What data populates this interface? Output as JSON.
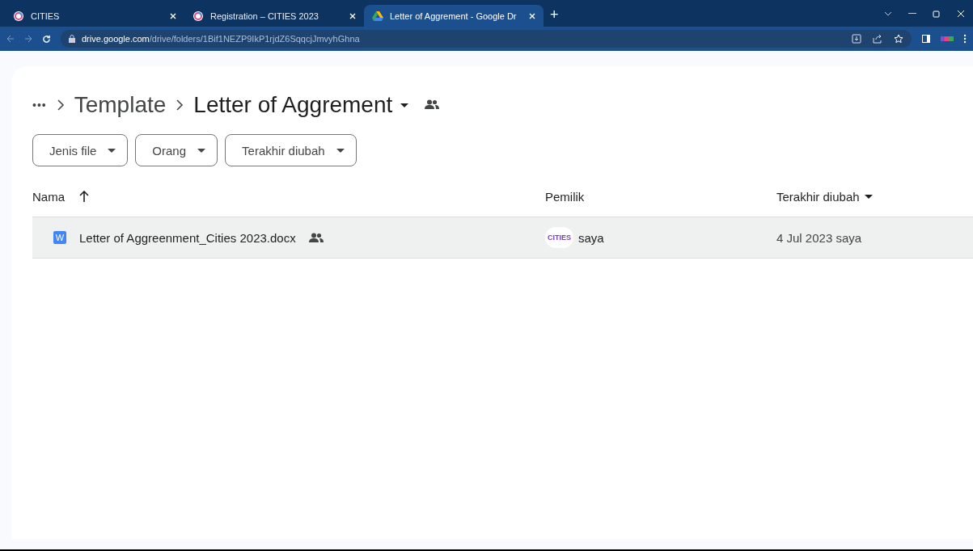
{
  "browser": {
    "tabs": [
      {
        "title": "CITIES",
        "selected": false
      },
      {
        "title": "Registration – CITIES 2023",
        "selected": false
      },
      {
        "title": "Letter of Aggrement - Google Dr",
        "selected": true
      }
    ],
    "new_tab": "+",
    "url_host": "drive.google.com",
    "url_path": "/drive/folders/1Bif1NEZP9IkP1rjdZ6SqqcjJmvyhGhna"
  },
  "breadcrumb": {
    "more": "•••",
    "items": [
      "Template",
      "Letter of Aggrement"
    ]
  },
  "filters": [
    "Jenis file",
    "Orang",
    "Terakhir diubah"
  ],
  "table": {
    "columns": [
      "Nama",
      "Pemilik",
      "Terakhir diubah"
    ],
    "rows": [
      {
        "name": "Letter of Aggreenment_Cities 2023.docx",
        "file_icon": "W",
        "owner_logo": "CITIES",
        "owner": "saya",
        "modified": "4 Jul 2023 saya",
        "selected": true
      }
    ]
  }
}
